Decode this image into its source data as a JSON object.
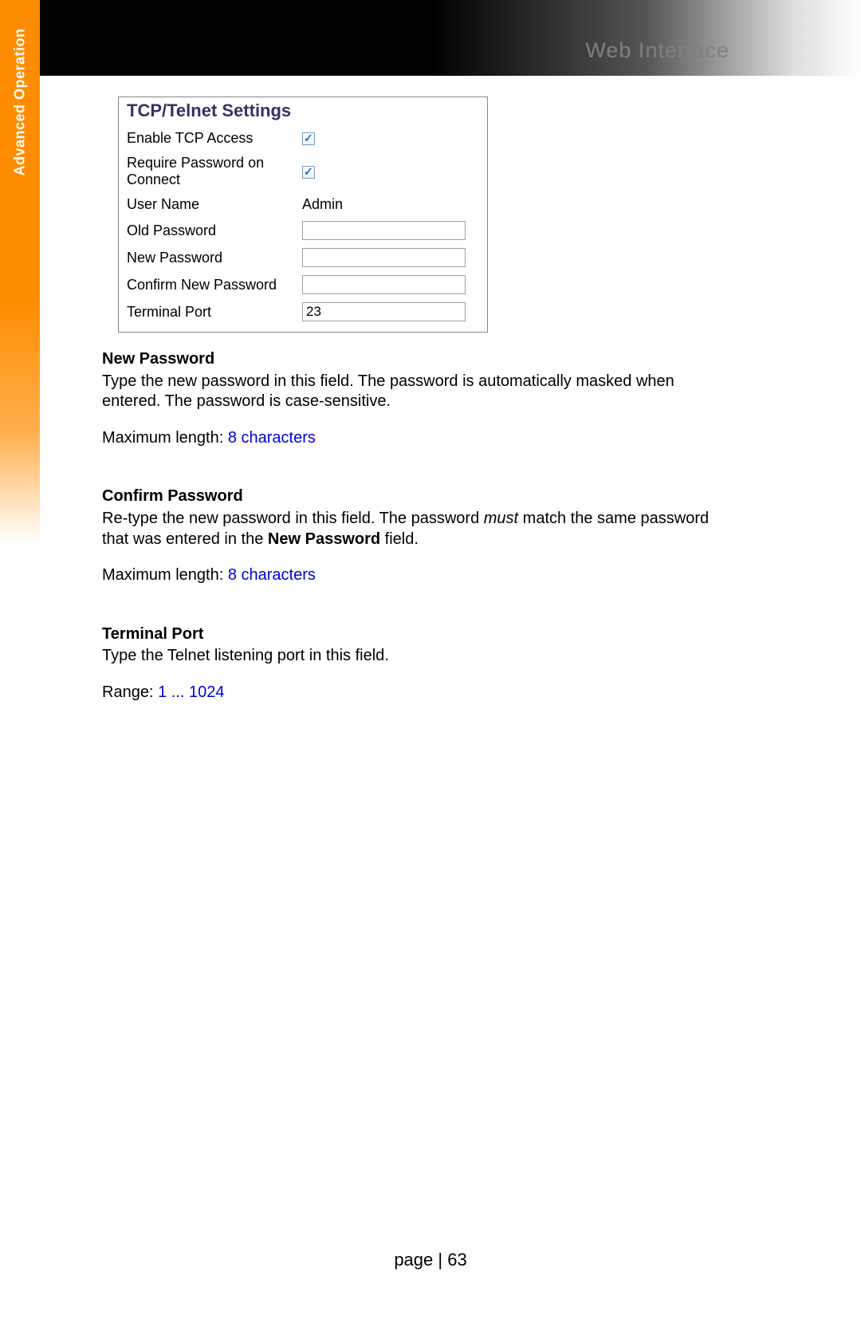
{
  "header": {
    "title": "Web Interface"
  },
  "sidebar": {
    "label": "Advanced Operation"
  },
  "settings_panel": {
    "title": "TCP/Telnet Settings",
    "rows": {
      "enable_tcp_label": "Enable TCP Access",
      "require_pw_label": "Require Password on Connect",
      "user_name_label": "User Name",
      "user_name_value": "Admin",
      "old_pw_label": "Old Password",
      "old_pw_value": "",
      "new_pw_label": "New Password",
      "new_pw_value": "",
      "confirm_pw_label": "Confirm New Password",
      "confirm_pw_value": "",
      "terminal_port_label": "Terminal Port",
      "terminal_port_value": "23"
    }
  },
  "doc": {
    "new_password": {
      "heading": "New Password",
      "body": "Type the new password in this field.  The password is automatically masked when entered.  The password is case-sensitive.",
      "max_label": "Maximum length:  ",
      "max_value": "8 characters"
    },
    "confirm_password": {
      "heading": "Confirm Password",
      "body_pre": "Re-type the new password in this field.  The password ",
      "body_em": "must",
      "body_mid": " match the same password that was entered in the ",
      "body_bold": "New Password",
      "body_post": " field.",
      "max_label": "Maximum length:  ",
      "max_value": "8 characters"
    },
    "terminal_port": {
      "heading": "Terminal Port",
      "body": "Type the Telnet listening port in this field.",
      "range_label": "Range:  ",
      "range_value": "1 ... 1024"
    }
  },
  "footer": {
    "page_label": "page | ",
    "page_number": "63"
  }
}
